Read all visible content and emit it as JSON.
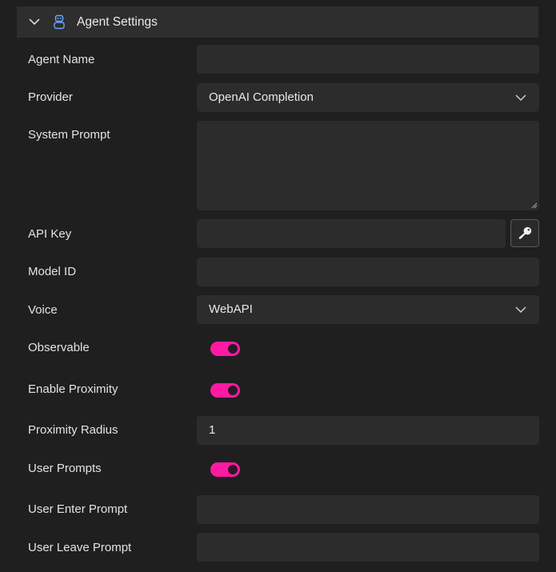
{
  "header": {
    "title": "Agent Settings",
    "collapse_icon": "chevron-down-icon",
    "agent_icon": "robot-icon"
  },
  "fields": {
    "agent_name": {
      "label": "Agent Name",
      "value": ""
    },
    "provider": {
      "label": "Provider",
      "value": "OpenAI Completion"
    },
    "system_prompt": {
      "label": "System Prompt",
      "value": ""
    },
    "api_key": {
      "label": "API Key",
      "value": "",
      "button_icon": "key-icon"
    },
    "model_id": {
      "label": "Model ID",
      "value": ""
    },
    "voice": {
      "label": "Voice",
      "value": "WebAPI"
    },
    "observable": {
      "label": "Observable",
      "checked": true
    },
    "enable_proximity": {
      "label": "Enable Proximity",
      "checked": true
    },
    "proximity_radius": {
      "label": "Proximity Radius",
      "value": "1"
    },
    "user_prompts": {
      "label": "User Prompts",
      "checked": true
    },
    "user_enter_prompt": {
      "label": "User Enter Prompt",
      "value": ""
    },
    "user_leave_prompt": {
      "label": "User Leave Prompt",
      "value": ""
    }
  },
  "colors": {
    "toggle_on": "#ff1aa3",
    "field_bg": "#2c2c2c",
    "panel_bg": "#1f1f1f",
    "header_bg": "#2e2e2e"
  }
}
